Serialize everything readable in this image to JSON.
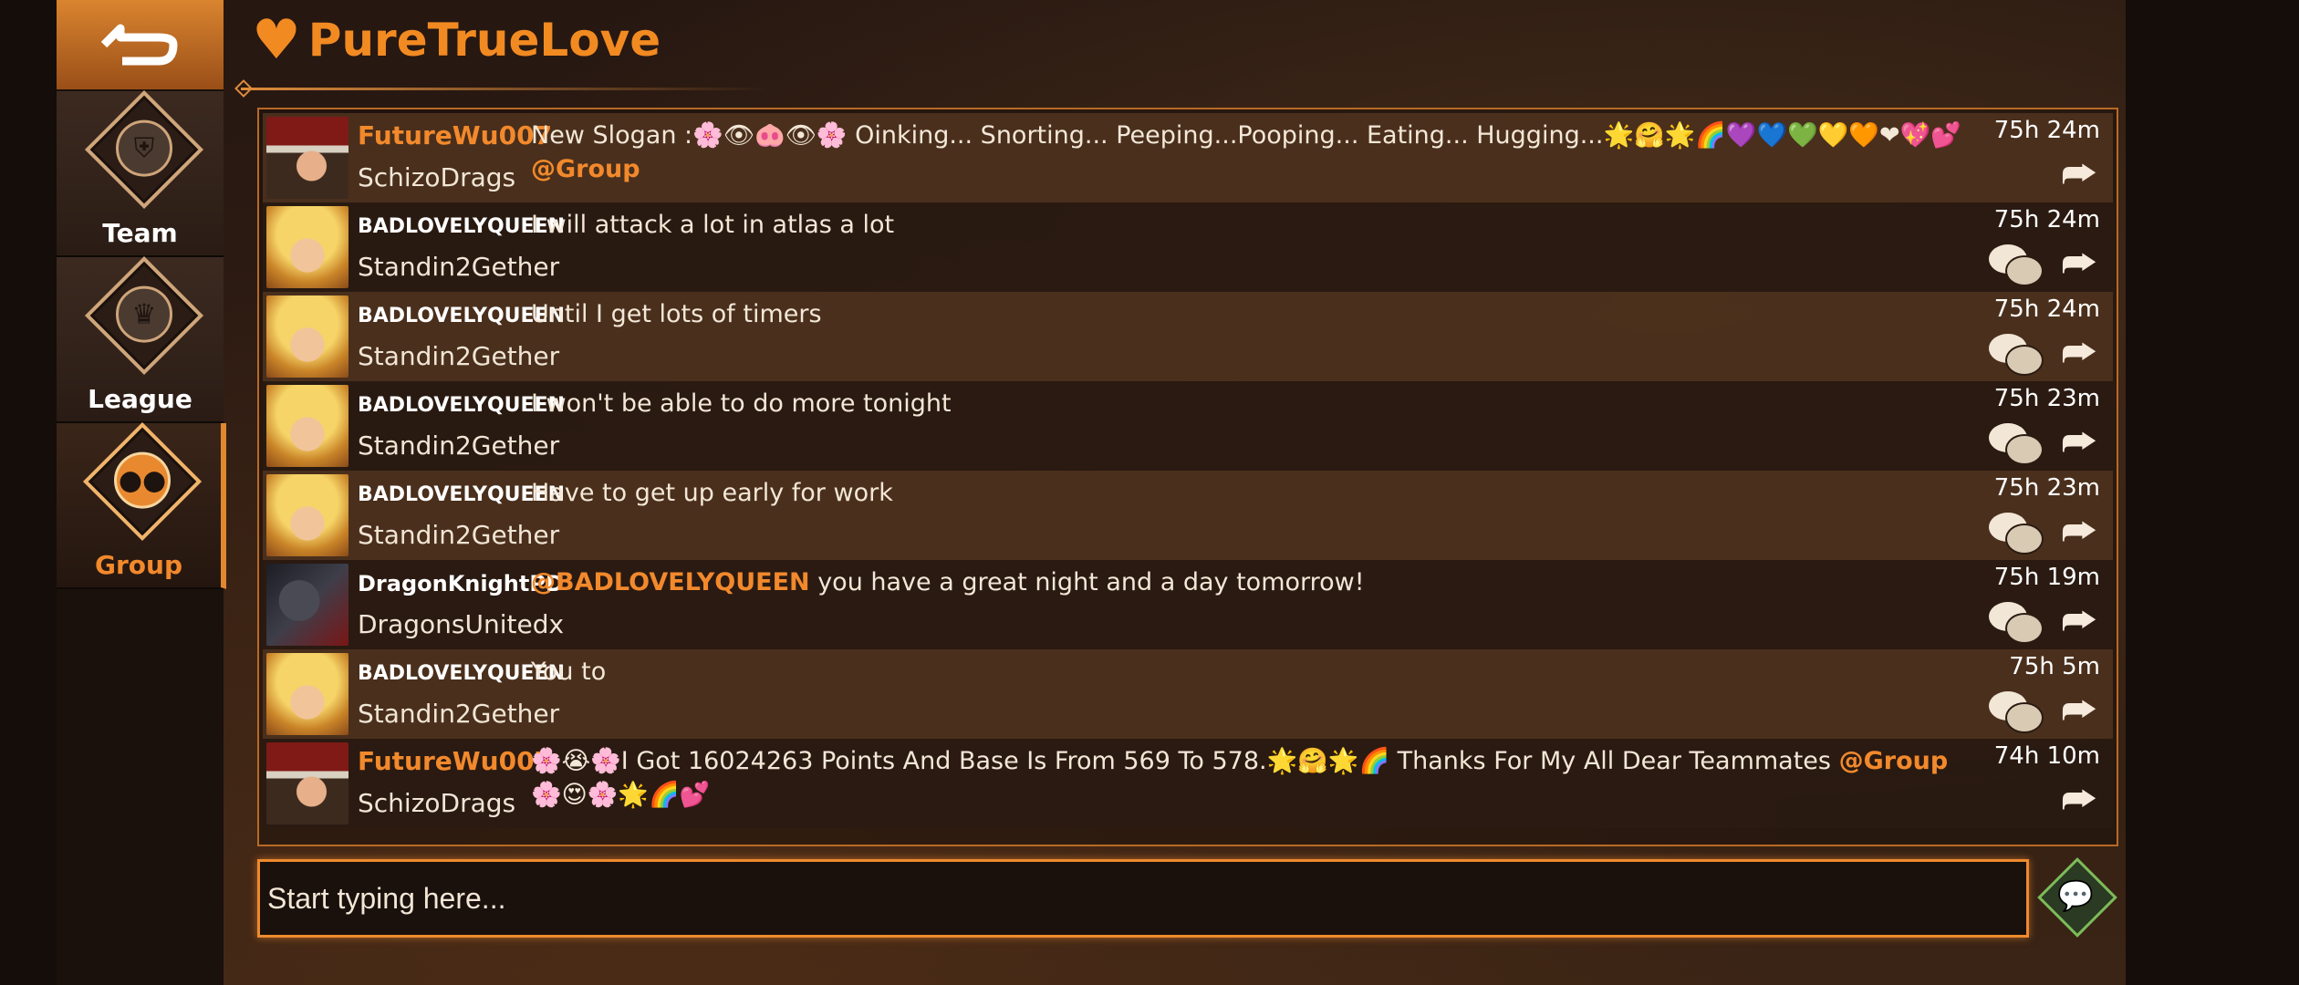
{
  "header": {
    "title": "PureTrueLove",
    "heart_icon": "heart-icon",
    "settings_icon": "gear-icon"
  },
  "sidebar": {
    "back_icon": "back-icon",
    "items": [
      {
        "label": "Team",
        "icon": "shield-icon",
        "active": false
      },
      {
        "label": "League",
        "icon": "trophy-icon",
        "active": false
      },
      {
        "label": "Group",
        "icon": "group-icon",
        "active": true
      }
    ]
  },
  "messages": [
    {
      "user": "FutureWu007",
      "team": "SchizoDrags",
      "text": "New Slogan :🌸👁🐽👁🌸 Oinking... Snorting... Peeping...Pooping... Eating... Hugging...🌟🤗🌟🌈💜💙💚💛🧡❤💖💕",
      "mention_after": "@Group",
      "time": "75h 24m",
      "reply": false
    },
    {
      "user": "BADLOVELYQUEEN",
      "team": "Standin2Gether",
      "text": "I will attack a lot in atlas a lot",
      "time": "75h 24m",
      "reply": true
    },
    {
      "user": "BADLOVELYQUEEN",
      "team": "Standin2Gether",
      "text": "Until I get lots of timers",
      "time": "75h 24m",
      "reply": true
    },
    {
      "user": "BADLOVELYQUEEN",
      "team": "Standin2Gether",
      "text": "I won't be able to do more tonight",
      "time": "75h 23m",
      "reply": true
    },
    {
      "user": "BADLOVELYQUEEN",
      "team": "Standin2Gether",
      "text": "Have to get up early for work",
      "time": "75h 23m",
      "reply": true
    },
    {
      "user": "DragonKnightPD",
      "team": "DragonsUnitedx",
      "mention_before": "@BADLOVELYQUEEN",
      "text": " you have a great night and a day tomorrow!",
      "time": "75h 19m",
      "reply": true
    },
    {
      "user": "BADLOVELYQUEEN",
      "team": "Standin2Gether",
      "text": "You to",
      "time": "75h 5m",
      "reply": true
    },
    {
      "user": "FutureWu007",
      "team": "SchizoDrags",
      "text": "🌸😭🌸I Got 16024263 Points And Base Is From 569 To 578.🌟🤗🌟🌈 Thanks For My All Dear Teammates",
      "mention_after": "@Group",
      "text2": "🌸😍🌸🌟🌈💕",
      "time": "74h 10m",
      "reply": false
    }
  ],
  "input": {
    "placeholder": "Start typing here..."
  },
  "send_icon": "chat-send-icon"
}
